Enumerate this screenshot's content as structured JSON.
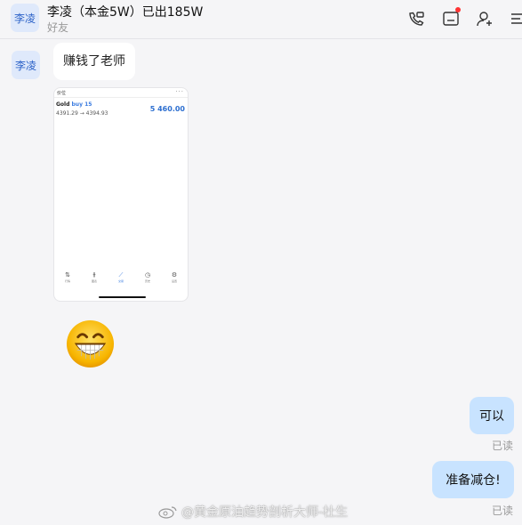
{
  "header": {
    "avatar_text": "李凌",
    "title": "李凌（本金5W）已出185W",
    "subtitle": "好友"
  },
  "messages": {
    "contact_avatar_text": "李凌",
    "text1": "赚钱了老师",
    "screenshot": {
      "header_label": "价位",
      "menu": "···",
      "symbol": "Gold",
      "order": "buy 15",
      "price_range": "4391.29 → 4394.93",
      "profit": "5 460.00",
      "nav": [
        {
          "icon": "⇅",
          "label": "行情"
        },
        {
          "icon": "⫵",
          "label": "图表"
        },
        {
          "icon": "⟋",
          "label": "交易"
        },
        {
          "icon": "◷",
          "label": "历史"
        },
        {
          "icon": "⚙",
          "label": "设置"
        }
      ]
    },
    "emoji": "grinning-face",
    "reply1": "可以",
    "reply1_status": "已读",
    "reply2": "准备减仓!",
    "reply2_status": "已读"
  },
  "watermark": "@黄金原油趋势剖析大师-杜生",
  "colors": {
    "accent": "#2d63c8",
    "bubble_right": "#c8e3ff",
    "unread_dot": "#ff3333"
  }
}
